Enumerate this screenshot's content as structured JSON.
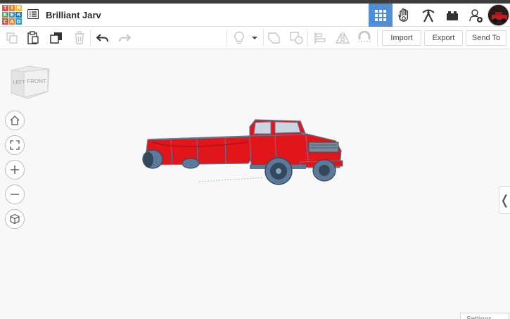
{
  "app": {
    "logo_letters": [
      "T",
      "I",
      "N",
      "K",
      "E",
      "R",
      "C",
      "A",
      "D"
    ],
    "logo_colors": [
      "#e94b3c",
      "#f58025",
      "#f7c022",
      "#4caf50",
      "#2d9cdb",
      "#1976d2",
      "#e94b3c",
      "#f58025",
      "#2d9cdb"
    ],
    "design_title": "Brilliant Jarv",
    "accent_color": "#4d8fd9"
  },
  "header": {
    "buttons": [
      {
        "name": "3d-design-grid-icon",
        "active": true
      },
      {
        "name": "codeblocks-hand-icon",
        "active": false
      },
      {
        "name": "pickaxe-icon",
        "active": false
      },
      {
        "name": "bricks-icon",
        "active": false
      },
      {
        "name": "add-user-icon",
        "active": false
      }
    ]
  },
  "toolbar": {
    "import_label": "Import",
    "export_label": "Export",
    "send_to_label": "Send To"
  },
  "viewcube": {
    "left_label": "LEFT",
    "front_label": "FRONT"
  },
  "viewport": {
    "settings_label": "Settings",
    "panel_toggle_label": "❬",
    "model_color": "#e0161b",
    "model_trim_color": "#5b7a9a"
  }
}
